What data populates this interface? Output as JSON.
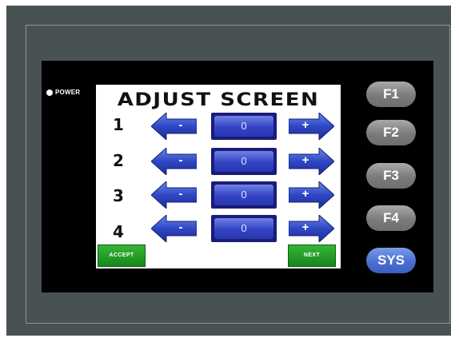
{
  "power": {
    "label": "POWER"
  },
  "screen": {
    "title": "ADJUST SCREEN",
    "rows": [
      {
        "label": "1",
        "minus": "-",
        "value": "0",
        "plus": "+"
      },
      {
        "label": "2",
        "minus": "-",
        "value": "0",
        "plus": "+"
      },
      {
        "label": "3",
        "minus": "-",
        "value": "0",
        "plus": "+"
      },
      {
        "label": "4",
        "minus": "-",
        "value": "0",
        "plus": "+"
      }
    ],
    "accept_label": "ACCEPT",
    "next_label": "NEXT"
  },
  "keys": {
    "f1": "F1",
    "f2": "F2",
    "f3": "F3",
    "f4": "F4",
    "sys": "SYS"
  },
  "colors": {
    "panel": "#485253",
    "arrow_blue": "#2f47c4",
    "value_blue": "#3443c4",
    "green_button": "#1f9a22",
    "function_key_gray": "#8a8a8a",
    "sys_key_blue": "#4a6fd1"
  }
}
